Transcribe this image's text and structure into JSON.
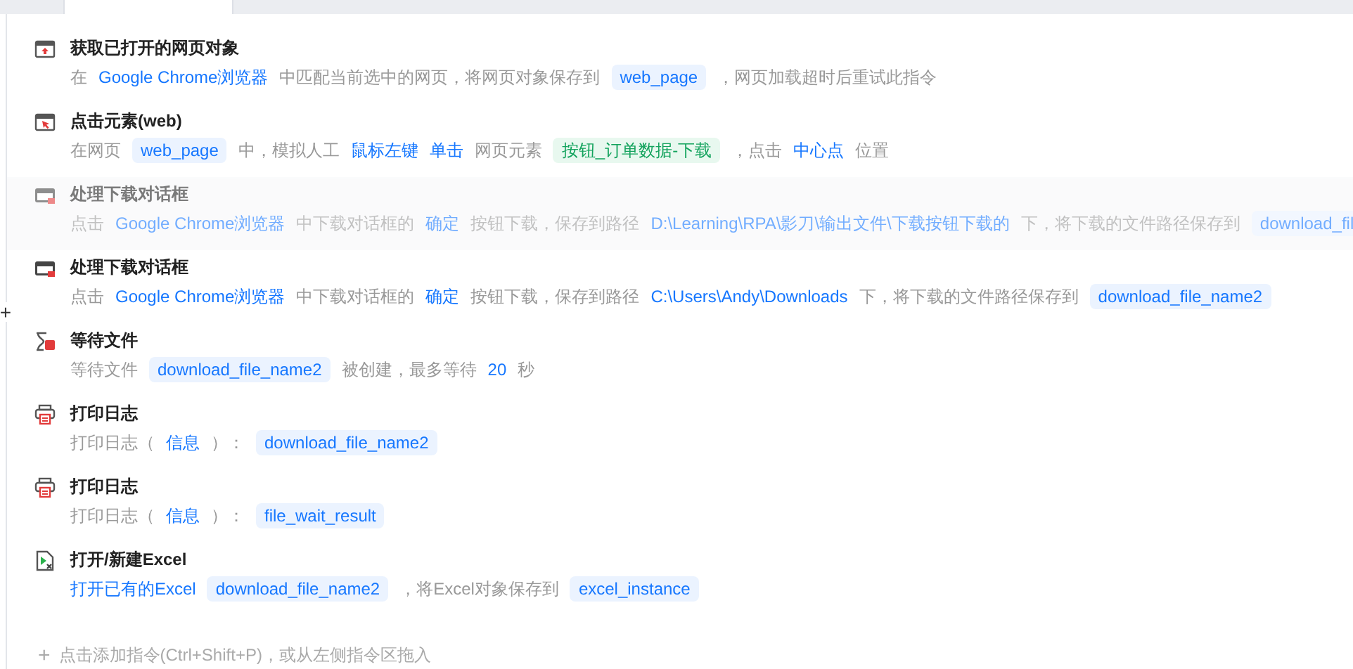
{
  "steps": [
    {
      "kind": "browser",
      "title": "获取已打开的网页对象",
      "disabled": false,
      "description": [
        {
          "kind": "text",
          "text": "在"
        },
        {
          "kind": "link",
          "text": "Google Chrome浏览器"
        },
        {
          "kind": "text",
          "text": "中匹配当前选中的网页，将网页对象保存到"
        },
        {
          "kind": "var",
          "text": "web_page"
        },
        {
          "kind": "text",
          "text": "，网页加载超时后重试此指令"
        }
      ]
    },
    {
      "kind": "click",
      "title": "点击元素(web)",
      "disabled": false,
      "description": [
        {
          "kind": "text",
          "text": "在网页"
        },
        {
          "kind": "var",
          "text": "web_page"
        },
        {
          "kind": "text",
          "text": "中，模拟人工"
        },
        {
          "kind": "link",
          "text": "鼠标左键"
        },
        {
          "kind": "link",
          "text": "单击"
        },
        {
          "kind": "text",
          "text": "网页元素"
        },
        {
          "kind": "tag",
          "text": "按钮_订单数据-下载"
        },
        {
          "kind": "text",
          "text": "，点击"
        },
        {
          "kind": "link",
          "text": "中心点"
        },
        {
          "kind": "text",
          "text": "位置"
        }
      ]
    },
    {
      "kind": "dialog",
      "title": "处理下载对话框",
      "disabled": true,
      "description": [
        {
          "kind": "text",
          "text": "点击"
        },
        {
          "kind": "link",
          "text": "Google Chrome浏览器"
        },
        {
          "kind": "text",
          "text": "中下载对话框的"
        },
        {
          "kind": "link",
          "text": "确定"
        },
        {
          "kind": "text",
          "text": "按钮下载，保存到路径"
        },
        {
          "kind": "link",
          "text": "D:\\Learning\\RPA\\影刀\\输出文件\\下载按钮下载的"
        },
        {
          "kind": "text",
          "text": "下，将下载的文件路径保存到"
        },
        {
          "kind": "var",
          "text": "download_fil"
        }
      ]
    },
    {
      "kind": "dialog",
      "title": "处理下载对话框",
      "disabled": false,
      "description": [
        {
          "kind": "text",
          "text": "点击"
        },
        {
          "kind": "link",
          "text": "Google Chrome浏览器"
        },
        {
          "kind": "text",
          "text": "中下载对话框的"
        },
        {
          "kind": "link",
          "text": "确定"
        },
        {
          "kind": "text",
          "text": "按钮下载，保存到路径"
        },
        {
          "kind": "link",
          "text": "C:\\Users\\Andy\\Downloads"
        },
        {
          "kind": "text",
          "text": "下，将下载的文件路径保存到"
        },
        {
          "kind": "var",
          "text": "download_file_name2"
        }
      ]
    },
    {
      "kind": "wait",
      "title": "等待文件",
      "disabled": false,
      "description": [
        {
          "kind": "text",
          "text": "等待文件"
        },
        {
          "kind": "var",
          "text": "download_file_name2"
        },
        {
          "kind": "text",
          "text": "被创建，最多等待"
        },
        {
          "kind": "link",
          "text": "20"
        },
        {
          "kind": "text",
          "text": "秒"
        }
      ]
    },
    {
      "kind": "print",
      "title": "打印日志",
      "disabled": false,
      "description": [
        {
          "kind": "text",
          "text": "打印日志（"
        },
        {
          "kind": "link",
          "text": "信息"
        },
        {
          "kind": "text",
          "text": "）："
        },
        {
          "kind": "var",
          "text": "download_file_name2"
        }
      ]
    },
    {
      "kind": "print",
      "title": "打印日志",
      "disabled": false,
      "description": [
        {
          "kind": "text",
          "text": "打印日志（"
        },
        {
          "kind": "link",
          "text": "信息"
        },
        {
          "kind": "text",
          "text": "）："
        },
        {
          "kind": "var",
          "text": "file_wait_result"
        }
      ]
    },
    {
      "kind": "excel",
      "title": "打开/新建Excel",
      "disabled": false,
      "description": [
        {
          "kind": "link",
          "text": "打开已有的Excel"
        },
        {
          "kind": "var",
          "text": "download_file_name2"
        },
        {
          "kind": "text",
          "text": "，将Excel对象保存到"
        },
        {
          "kind": "var",
          "text": "excel_instance"
        }
      ]
    }
  ],
  "add_hint": {
    "icon": "+",
    "text": "点击添加指令(Ctrl+Shift+P)，或从左侧指令区拖入"
  },
  "gutter_add": "+"
}
